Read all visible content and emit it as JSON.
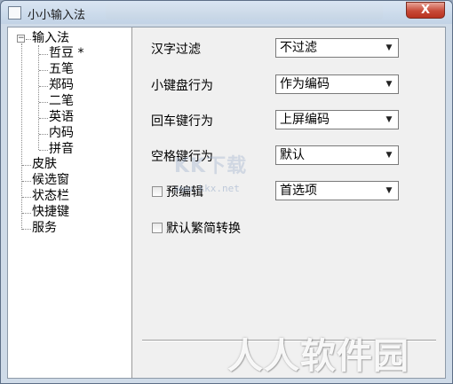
{
  "window": {
    "title": "小小输入法",
    "close_icon": "close-icon",
    "close_glyph": "X"
  },
  "tree": {
    "root_label": "输入法",
    "expander_glyph": "−",
    "children": [
      "哲豆 *",
      "五笔",
      "郑码",
      "二笔",
      "英语",
      "内码",
      "拼音"
    ],
    "siblings": [
      "皮肤",
      "候选窗",
      "状态栏",
      "快捷键",
      "服务"
    ]
  },
  "form": {
    "rows": [
      {
        "label": "汉字过滤",
        "value": "不过滤"
      },
      {
        "label": "小键盘行为",
        "value": "作为编码"
      },
      {
        "label": "回车键行为",
        "value": "上屏编码"
      },
      {
        "label": "空格键行为",
        "value": "默认"
      }
    ],
    "preedit": {
      "label": "预编辑",
      "checked": false,
      "value": "首选项"
    },
    "trad_simp": {
      "label": "默认繁简转换",
      "checked": false
    },
    "arrow_glyph": "▼"
  },
  "watermarks": {
    "kk_text": "KK下载",
    "kk_url": "www.kkx.net",
    "site_text": "人人软件园"
  }
}
